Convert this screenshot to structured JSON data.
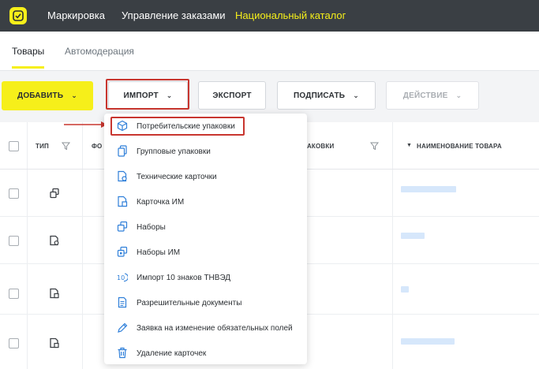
{
  "header": {
    "nav": [
      {
        "label": "Маркировка",
        "active": false
      },
      {
        "label": "Управление заказами",
        "active": false
      },
      {
        "label": "Национальный каталог",
        "active": true
      }
    ],
    "accent_color": "#f6ef1a"
  },
  "tabs": [
    {
      "label": "Товары",
      "active": true
    },
    {
      "label": "Автомодерация",
      "active": false
    }
  ],
  "toolbar": {
    "add_label": "ДОБАВИТЬ",
    "import_label": "ИМПОРТ",
    "export_label": "ЭКСПОРТ",
    "sign_label": "ПОДПИСАТЬ",
    "action_label": "ДЕЙСТВИЕ"
  },
  "table": {
    "columns": {
      "type": "ТИП",
      "photo": "ФО",
      "packages": "ПАКОВКИ",
      "name": "НАИМЕНОВАНИЕ ТОВАРА"
    },
    "rows": [
      {
        "type_icon": "group-package-icon"
      },
      {
        "type_icon": "tech-card-icon"
      },
      {
        "type_icon": "card-im-icon"
      },
      {
        "type_icon": "card-im-icon"
      }
    ]
  },
  "import_menu": {
    "items": [
      {
        "label": "Потребительские упаковки",
        "icon": "box-icon",
        "highlighted": true
      },
      {
        "label": "Групповые упаковки",
        "icon": "group-package-icon"
      },
      {
        "label": "Технические карточки",
        "icon": "tech-card-icon"
      },
      {
        "label": "Карточка ИМ",
        "icon": "card-im-icon"
      },
      {
        "label": "Наборы",
        "icon": "set-icon"
      },
      {
        "label": "Наборы ИМ",
        "icon": "set-im-icon"
      },
      {
        "label": "Импорт 10 знаков ТНВЭД",
        "icon": "tnved-10-icon"
      },
      {
        "label": "Разрешительные документы",
        "icon": "document-icon"
      },
      {
        "label": "Заявка на изменение обязательных полей",
        "icon": "pencil-icon"
      },
      {
        "label": "Удаление карточек",
        "icon": "trash-icon"
      }
    ]
  }
}
